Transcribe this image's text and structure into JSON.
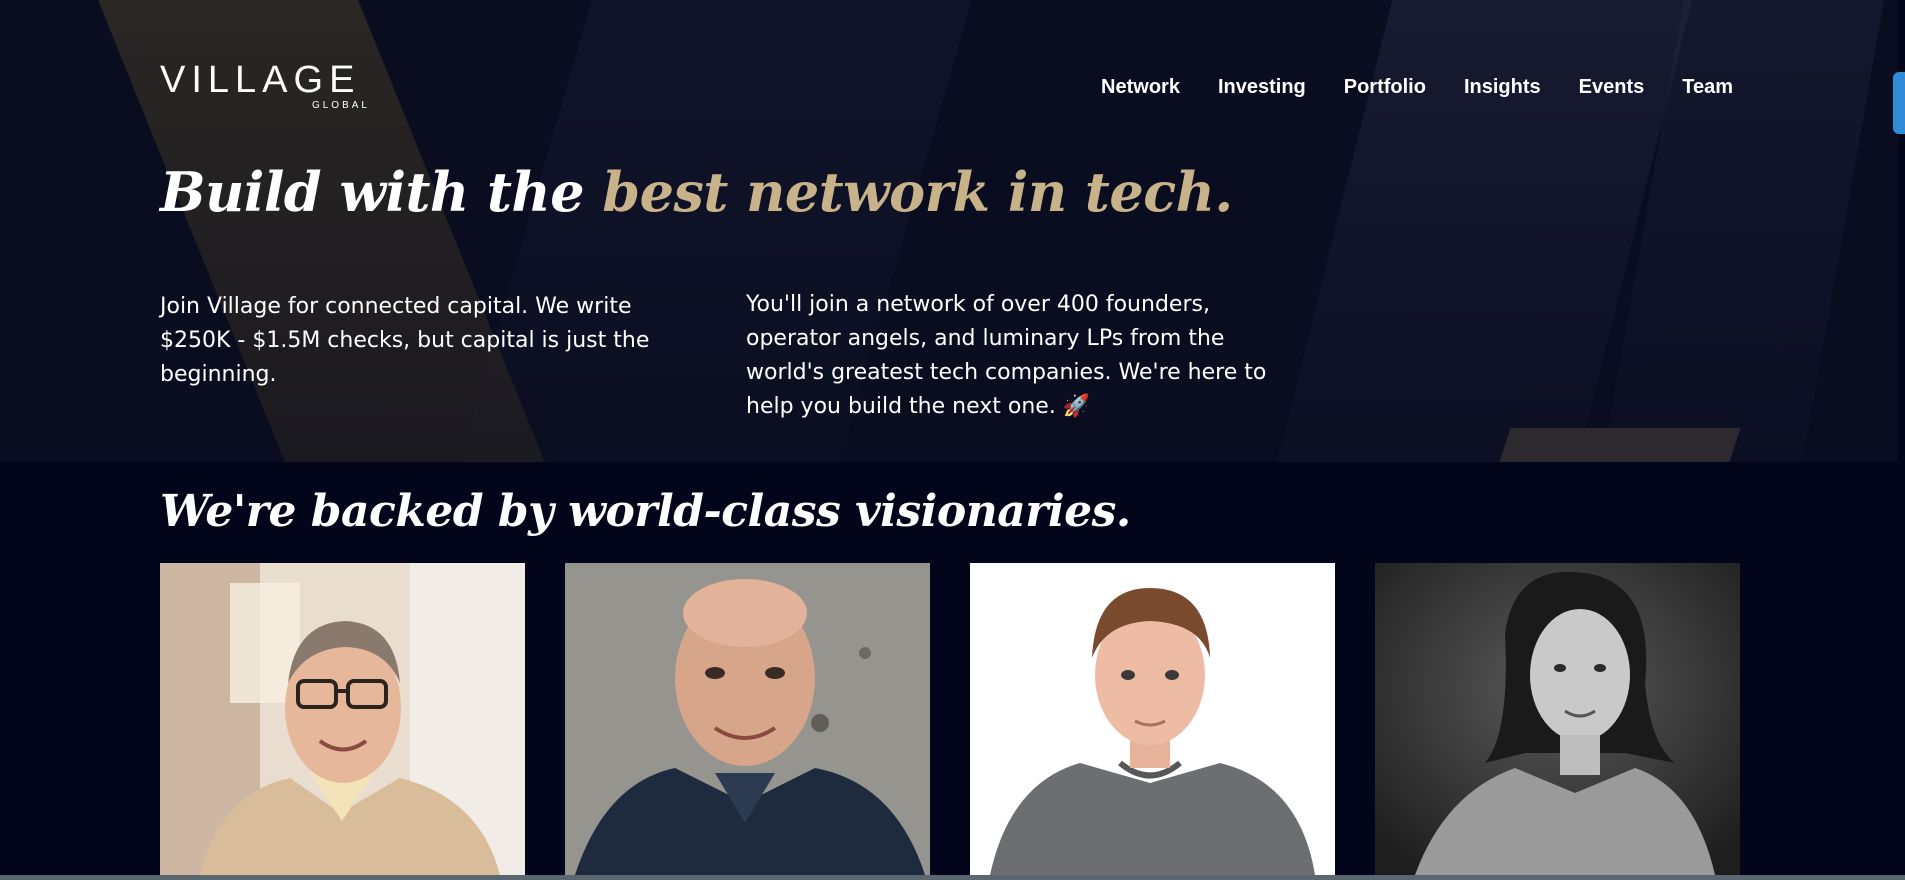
{
  "brand": {
    "logo_text": "VILLAGE",
    "logo_sub": "GLOBAL"
  },
  "nav": {
    "items": [
      {
        "label": "Network"
      },
      {
        "label": "Investing"
      },
      {
        "label": "Portfolio"
      },
      {
        "label": "Insights"
      },
      {
        "label": "Events"
      },
      {
        "label": "Team"
      }
    ]
  },
  "hero": {
    "headline_part1": "Build with the ",
    "headline_accent": "best network in tech.",
    "intro_left": "Join Village for connected capital. We write $250K - $1.5M checks, but capital is just the beginning.",
    "intro_right": "You'll join a network of over 400 founders, operator angels, and luminary LPs from the world's greatest tech companies. We're here to help you build the next one. 🚀"
  },
  "backers": {
    "title": "We're backed by world-class visionaries."
  },
  "colors": {
    "background": "#03061a",
    "accent_gold": "#c8b28a",
    "scroll_tab": "#2f8ad8"
  }
}
